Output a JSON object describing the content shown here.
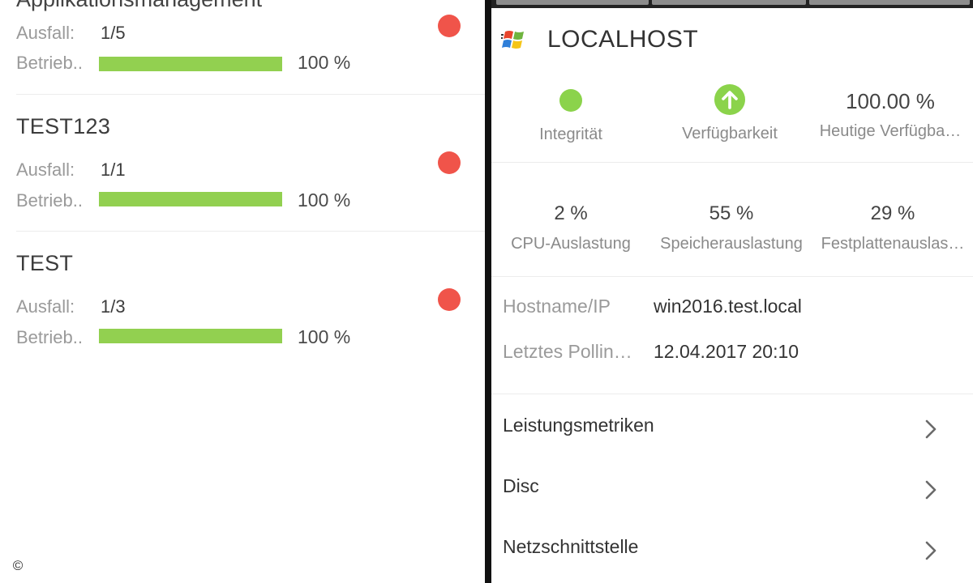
{
  "left": {
    "cut_title": "Applikationsmanagement",
    "groups": [
      {
        "title": "",
        "ausfall_label": "Ausfall:",
        "ausfall_value": "1/5",
        "betrieb_label": "Betrieb..",
        "uptime_fraction": 1.0,
        "uptime_text": "100 %",
        "status_color": "#f0544a"
      },
      {
        "title": "TEST123",
        "ausfall_label": "Ausfall:",
        "ausfall_value": "1/1",
        "betrieb_label": "Betrieb..",
        "uptime_fraction": 1.0,
        "uptime_text": "100 %",
        "status_color": "#f0544a"
      },
      {
        "title": "TEST",
        "ausfall_label": "Ausfall:",
        "ausfall_value": "1/3",
        "betrieb_label": "Betrieb..",
        "uptime_fraction": 1.0,
        "uptime_text": "100 %",
        "status_color": "#f0544a"
      }
    ],
    "copyright": "©"
  },
  "right": {
    "host_title": "LOCALHOST",
    "host_icon": "windows-logo-icon",
    "status": {
      "integrity_label": "Integrität",
      "availability_label": "Verfügbarkeit",
      "today_value": "100.00 %",
      "today_label": "Heutige Verfügba…"
    },
    "metrics": [
      {
        "value": "2 %",
        "label": "CPU-Auslastung"
      },
      {
        "value": "55 %",
        "label": "Speicherauslastung"
      },
      {
        "value": "29 %",
        "label": "Festplattenauslas…"
      }
    ],
    "info": {
      "hostname_label": "Hostname/IP",
      "hostname_value": "win2016.test.local",
      "polling_label": "Letztes Pollin…",
      "polling_value": "12.04.2017 20:10"
    },
    "nav": [
      {
        "label": "Leistungsmetriken"
      },
      {
        "label": "Disc"
      },
      {
        "label": "Netzschnittstelle"
      }
    ],
    "colors": {
      "ok_green": "#8bd34b",
      "alert_red": "#f0544a",
      "bar_green": "#92d050"
    }
  }
}
